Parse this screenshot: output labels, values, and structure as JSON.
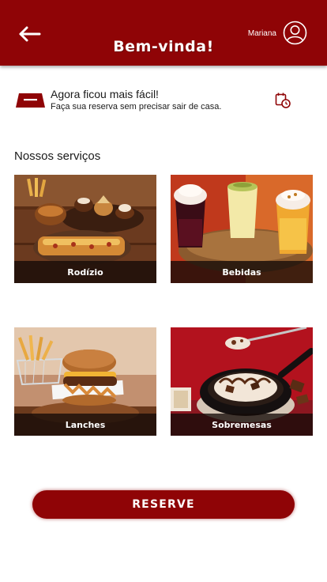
{
  "header": {
    "title": "Bem-vinda!",
    "user_name": "Mariana",
    "back_icon": "arrow-left-icon",
    "avatar_icon": "user-circle-icon",
    "color": "#8f0406"
  },
  "banner": {
    "icon": "reservation-sign-icon",
    "title": "Agora ficou mais fácil!",
    "subtitle": "Faça sua reserva sem precisar sair de casa.",
    "action_icon": "calendar-clock-icon"
  },
  "services": {
    "title": "Nossos serviços",
    "items": [
      {
        "label": "Rodízio"
      },
      {
        "label": "Bebidas"
      },
      {
        "label": "Lanches"
      },
      {
        "label": "Sobremesas"
      }
    ]
  },
  "reserve_button": {
    "label": "RESERVE",
    "color": "#8f0406"
  }
}
